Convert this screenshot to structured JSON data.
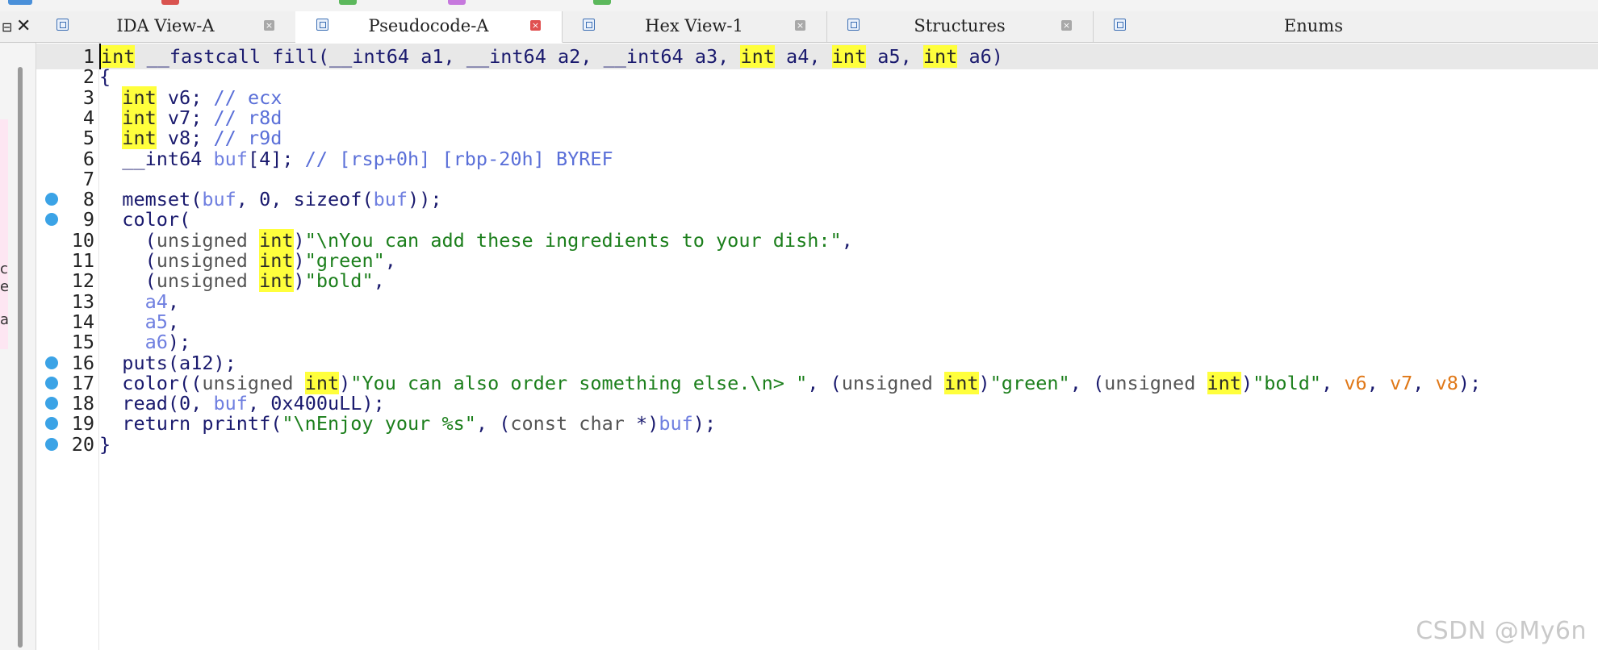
{
  "tabs": [
    {
      "label": "IDA View-A",
      "active": false
    },
    {
      "label": "Pseudocode-A",
      "active": true
    },
    {
      "label": "Hex View-1",
      "active": false
    },
    {
      "label": "Structures",
      "active": false
    },
    {
      "label": "Enums",
      "active": false
    }
  ],
  "left_fragments": [
    "c",
    "e",
    "a"
  ],
  "code": {
    "line_numbers": [
      "1",
      "2",
      "3",
      "4",
      "5",
      "6",
      "7",
      "8",
      "9",
      "10",
      "11",
      "12",
      "13",
      "14",
      "15",
      "16",
      "17",
      "18",
      "19",
      "20"
    ],
    "breakpoint_lines": [
      8,
      9,
      16,
      17,
      18,
      19,
      20
    ],
    "lines": [
      "int __fastcall fill(__int64 a1, __int64 a2, __int64 a3, int a4, int a5, int a6)",
      "{",
      "  int v6; // ecx",
      "  int v7; // r8d",
      "  int v8; // r9d",
      "  __int64 buf[4]; // [rsp+0h] [rbp-20h] BYREF",
      "",
      "  memset(buf, 0, sizeof(buf));",
      "  color(",
      "    (unsigned int)\"\\nYou can add these ingredients to your dish:\",",
      "    (unsigned int)\"green\",",
      "    (unsigned int)\"bold\",",
      "    a4,",
      "    a5,",
      "    a6);",
      "  puts(a12);",
      "  color((unsigned int)\"You can also order something else.\\n> \", (unsigned int)\"green\", (unsigned int)\"bold\", v6, v7, v8);",
      "  read(0, buf, 0x400uLL);",
      "  return printf(\"\\nEnjoy your %s\", (const char *)buf);",
      "}"
    ]
  },
  "watermark": "CSDN @My6n",
  "colors": {
    "keyword_highlight": "#ffff3c",
    "string": "#1c7f1c",
    "comment": "#5a6fd8",
    "variable": "#6f7fe0",
    "register_var": "#e07818",
    "breakpoint": "#3ba3e6"
  }
}
